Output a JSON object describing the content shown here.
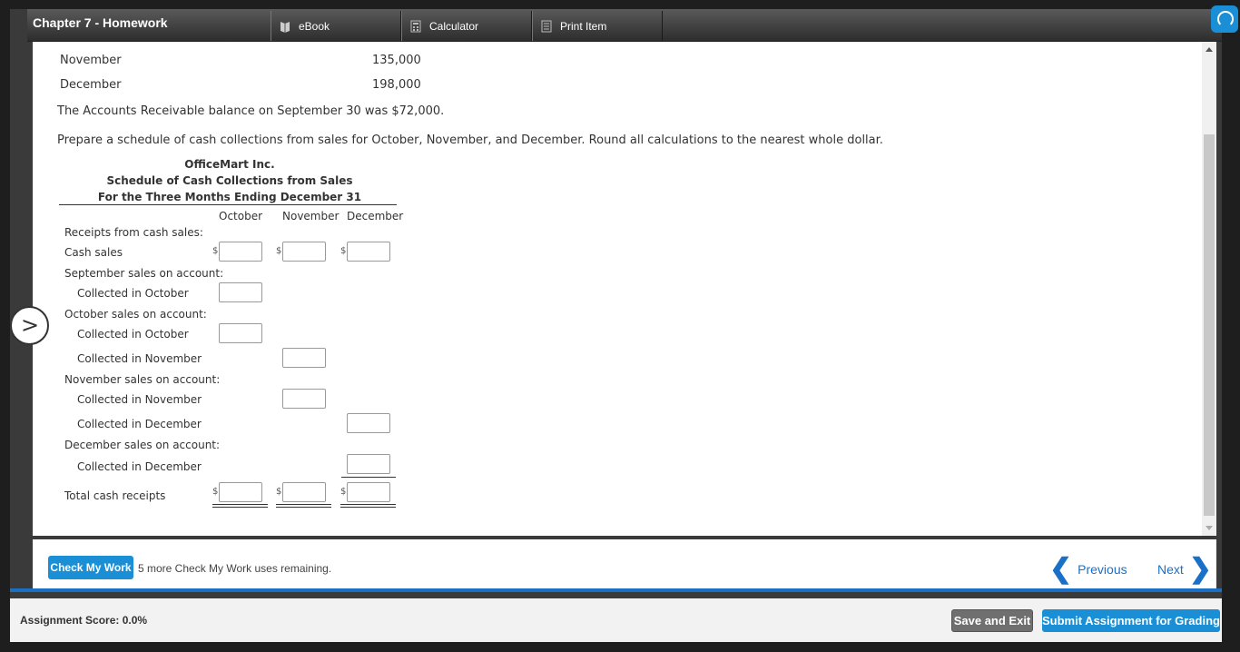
{
  "header": {
    "title": "Chapter 7 - Homework",
    "tabs": [
      {
        "label": "eBook",
        "icon": "book-icon"
      },
      {
        "label": "Calculator",
        "icon": "calculator-icon"
      },
      {
        "label": "Print Item",
        "icon": "print-icon"
      }
    ]
  },
  "sales_rows": [
    {
      "month": "November",
      "amount": "135,000"
    },
    {
      "month": "December",
      "amount": "198,000"
    }
  ],
  "ar_text": "The Accounts Receivable balance on September 30 was $72,000.",
  "instruction": "Prepare a schedule of cash collections from sales for October, November, and December. Round all calculations to the nearest whole dollar.",
  "schedule": {
    "company": "OfficeMart Inc.",
    "title": "Schedule of Cash Collections from Sales",
    "period": "For the Three Months Ending December 31",
    "columns": [
      "October",
      "November",
      "December"
    ],
    "currency": "$",
    "rows": {
      "receipts_header": "Receipts from cash sales:",
      "cash_sales": "Cash sales",
      "sep_header": "September sales on account:",
      "sep_oct": "Collected in October",
      "oct_header": "October sales on account:",
      "oct_oct": "Collected in October",
      "oct_nov": "Collected in November",
      "nov_header": "November sales on account:",
      "nov_nov": "Collected in November",
      "nov_dec": "Collected in December",
      "dec_header": "December sales on account:",
      "dec_dec": "Collected in December",
      "total": "Total cash receipts"
    }
  },
  "footer": {
    "check_label": "Check My Work",
    "check_note": "5 more Check My Work uses remaining.",
    "previous": "Previous",
    "next": "Next"
  },
  "bottom": {
    "score": "Assignment Score: 0.0%",
    "save": "Save and Exit",
    "submit": "Submit Assignment for Grading"
  },
  "colors": {
    "accent": "#1a8fd6",
    "link": "#1a70c6",
    "topbar": "#3a3a3a"
  }
}
